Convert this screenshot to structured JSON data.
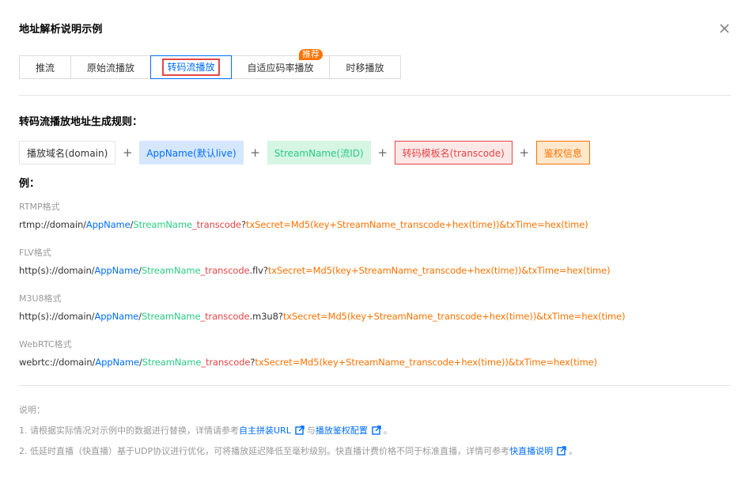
{
  "dialog": {
    "title": "地址解析说明示例",
    "close_icon": "close-icon"
  },
  "tabs": [
    {
      "label": "推流",
      "active": false
    },
    {
      "label": "原始流播放",
      "active": false
    },
    {
      "label": "转码流播放",
      "active": true
    },
    {
      "label": "自适应码率播放",
      "active": false,
      "badge": "推荐"
    },
    {
      "label": "时移播放",
      "active": false
    }
  ],
  "rule": {
    "title": "转码流播放地址生成规则：",
    "parts": [
      "播放域名(domain)",
      "AppName(默认live)",
      "StreamName(流ID)",
      "转码模板名(transcode)",
      "鉴权信息"
    ],
    "plus": "+"
  },
  "examples": {
    "label": "例：",
    "rtmp": {
      "label": "RTMP格式",
      "prefix": "rtmp://domain/",
      "app": "AppName",
      "slash": "/",
      "stream": "StreamName",
      "tpl": "_transcode",
      "ext": "",
      "qmark": "?",
      "auth": "txSecret=Md5(key+StreamName_transcode+hex(time))&txTime=hex(time)"
    },
    "flv": {
      "label": "FLV格式",
      "prefix": "http(s)://domain/",
      "app": "AppName",
      "slash": "/",
      "stream": "StreamName",
      "tpl": "_transcode",
      "ext": ".flv",
      "qmark": "?",
      "auth": "txSecret=Md5(key+StreamName_transcode+hex(time))&txTime=hex(time)"
    },
    "m3u8": {
      "label": "M3U8格式",
      "prefix": "http(s)://domain/",
      "app": "AppName",
      "slash": "/",
      "stream": "StreamName",
      "tpl": "_transcode",
      "ext": ".m3u8",
      "qmark": "?",
      "auth": "txSecret=Md5(key+StreamName_transcode+hex(time))&txTime=hex(time)"
    },
    "webrtc": {
      "label": "WebRTC格式",
      "prefix": "webrtc://domain/",
      "app": "AppName",
      "slash": "/",
      "stream": "StreamName",
      "tpl": "_transcode",
      "ext": "",
      "qmark": "?",
      "auth": "txSecret=Md5(key+StreamName_transcode+hex(time))&txTime=hex(time)"
    }
  },
  "notes": {
    "title": "说明：",
    "note1": {
      "text_a": "1. 请根据实际情况对示例中的数据进行替换，详情请参考 ",
      "link_a": "自主拼装URL",
      "text_b": " 与",
      "link_b": "播放鉴权配置",
      "text_c": " 。"
    },
    "note2": {
      "text_a": "2. 低延时直播（快直播）基于UDP协议进行优化，可将播放延迟降低至毫秒级别。快直播计费价格不同于标准直播，详情可参考 ",
      "link_a": "快直播说明",
      "text_c": " 。"
    },
    "link_icon": "external-link-icon"
  },
  "colors": {
    "blue": "#006eff",
    "green": "#29cc85",
    "red": "#e54545",
    "orange": "#ff7200",
    "muted": "#999999"
  }
}
